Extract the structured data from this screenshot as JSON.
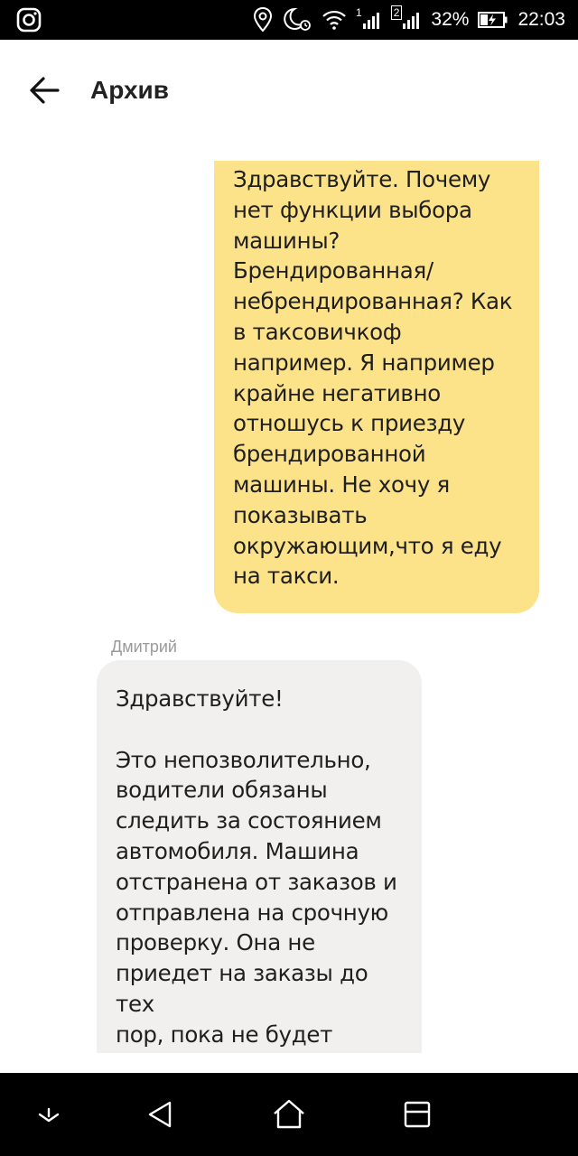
{
  "status_bar": {
    "battery": "32%",
    "time": "22:03",
    "sim1": "1",
    "sim2": "2",
    "icons": [
      "instagram-icon",
      "location-icon",
      "alarm-moon-icon",
      "wifi-icon",
      "signal-icon",
      "battery-charging-icon"
    ]
  },
  "header": {
    "title": "Архив",
    "back_icon": "arrow-left-icon"
  },
  "messages": [
    {
      "direction": "outgoing",
      "text": "Здравствуйте. Почему\nнет функции выбора\nмашины?\nБрендированная/\nнебрендированная? Как\nв таксовичкоф\nнапример. Я например\nкрайне негативно\nотношусь к приезду\nбрендированной\nмашины. Не хочу я\nпоказывать\nокружающим,что я еду\nна такси."
    },
    {
      "direction": "incoming",
      "sender": "Дмитрий",
      "text": "Здравствуйте!\n\nЭто непозволительно,\nводители обязаны\nследить за состоянием\nавтомобиля. Машина\nотстранена от заказов и\nотправлена на срочную\nпроверку. Она не\nприедет на заказы до тех\nпор, пока не будет\nсоответствовать всем\nтребованиям."
    }
  ],
  "nav_bar": {
    "icons": [
      "notifications-pull-icon",
      "back-triangle-icon",
      "home-icon",
      "recent-apps-icon"
    ]
  },
  "colors": {
    "outgoing_bubble": "#fce38a",
    "incoming_bubble": "#f1f0ee",
    "bars": "#000000"
  }
}
